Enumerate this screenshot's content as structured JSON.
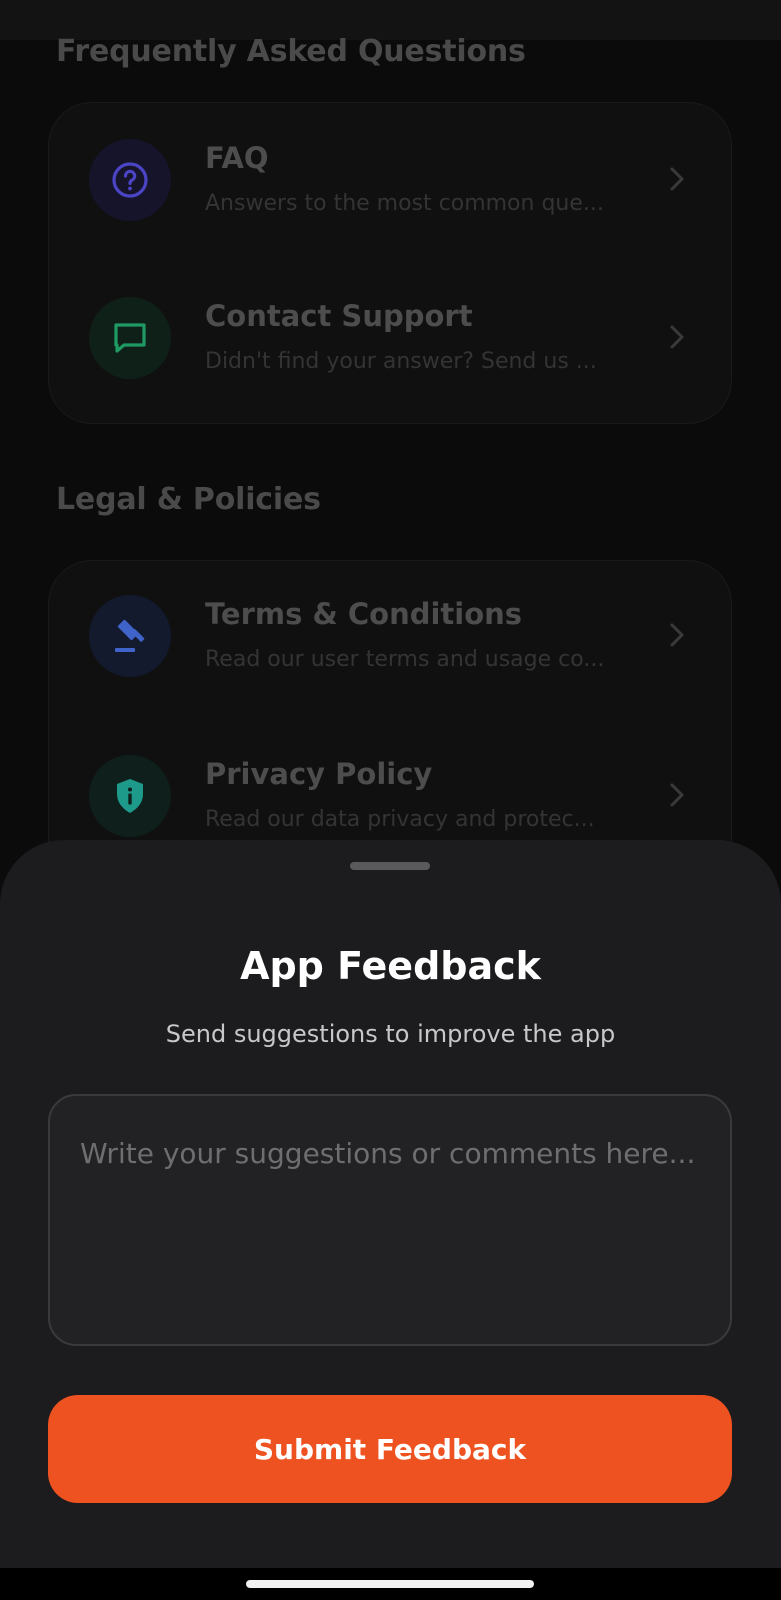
{
  "sections": {
    "faq_heading": "Frequently Asked Questions",
    "legal_heading": "Legal & Policies"
  },
  "faq_items": [
    {
      "title": "FAQ",
      "subtitle": "Answers to the most common que...",
      "icon": "question-circle-icon",
      "color": "#4b45c6"
    },
    {
      "title": "Contact Support",
      "subtitle": "Didn't find your answer? Send us ...",
      "icon": "chat-bubble-icon",
      "color": "#1f9a63"
    }
  ],
  "legal_items": [
    {
      "title": "Terms & Conditions",
      "subtitle": "Read our user terms and usage co...",
      "icon": "gavel-icon",
      "color": "#3f63c9"
    },
    {
      "title": "Privacy Policy",
      "subtitle": "Read our data privacy and protec...",
      "icon": "shield-info-icon",
      "color": "#1d9a8a"
    }
  ],
  "sheet": {
    "title": "App Feedback",
    "subtitle": "Send suggestions to improve the app",
    "placeholder": "Write your suggestions or comments here...",
    "value": "",
    "submit_label": "Submit Feedback"
  },
  "colors": {
    "accent": "#ee5220",
    "sheet_bg": "#1c1c1e"
  }
}
